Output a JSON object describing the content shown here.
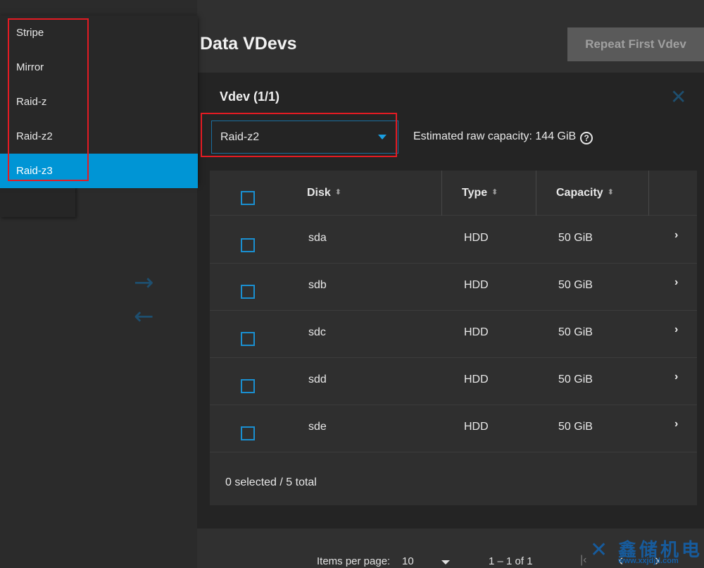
{
  "header": {
    "title": "Data VDevs",
    "repeat_button": "Repeat First Vdev"
  },
  "dropdown": {
    "options": [
      "Stripe",
      "Mirror",
      "Raid-z",
      "Raid-z2",
      "Raid-z3"
    ],
    "highlighted": "Raid-z3"
  },
  "vdev": {
    "title": "Vdev (1/1)",
    "layout_value": "Raid-z2",
    "capacity": "Estimated raw capacity: 144 GiB",
    "help_icon": "?"
  },
  "table": {
    "columns": [
      "Disk",
      "Type",
      "Capacity"
    ],
    "rows": [
      {
        "disk": "sda",
        "type": "HDD",
        "capacity": "50 GiB"
      },
      {
        "disk": "sdb",
        "type": "HDD",
        "capacity": "50 GiB"
      },
      {
        "disk": "sdc",
        "type": "HDD",
        "capacity": "50 GiB"
      },
      {
        "disk": "sdd",
        "type": "HDD",
        "capacity": "50 GiB"
      },
      {
        "disk": "sde",
        "type": "HDD",
        "capacity": "50 GiB"
      }
    ],
    "footer": "0 selected / 5 total"
  },
  "pagination": {
    "items_per_page_label": "Items per page:",
    "items_per_page_value": "10",
    "range": "1 – 1 of 1"
  },
  "watermark": {
    "text": "鑫储机电",
    "url": "www.xxjdjd.com"
  },
  "colors": {
    "accent": "#0095d5",
    "highlight_box": "#e31b23",
    "background": "#303030"
  }
}
